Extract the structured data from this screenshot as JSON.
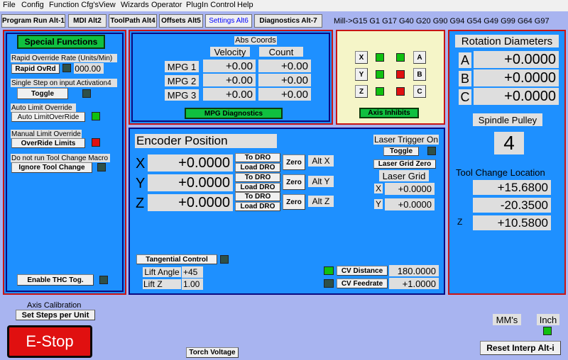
{
  "menu": [
    "File",
    "Config",
    "Function Cfg's",
    "View",
    "Wizards",
    "Operator",
    "PlugIn Control",
    "Help"
  ],
  "tabs": [
    "Program Run Alt-1",
    "MDI Alt2",
    "ToolPath Alt4",
    "Offsets Alt5",
    "Settings Alt6",
    "Diagnostics Alt-7"
  ],
  "active_tab": "Settings Alt6",
  "gcodes": "Mill->G15  G1 G17 G40 G20 G90 G94 G54 G49 G99 G64 G97",
  "special": {
    "title": "Special Functions",
    "rapid_label": "Rapid Override Rate (Units/Min)",
    "rapid_btn": "Rapid OvRd",
    "rapid_value": "000.00",
    "single_step_label": "Single Step on input Activation4",
    "toggle_btn": "Toggle",
    "auto_limit_label": "Auto Limit Override",
    "auto_limit_btn": "Auto LimitOverRide",
    "manual_limit_label": "Manual Limit Override",
    "override_btn": "OverRide Limits",
    "tool_change_label": "Do not run Tool Change Macro",
    "ignore_btn": "Ignore Tool Change",
    "thc_btn": "Enable THC Tog."
  },
  "mpg": {
    "title": "Abs Coords",
    "col_velocity": "Velocity",
    "col_count": "Count",
    "rows": [
      {
        "label": "MPG 1",
        "velocity": "+0.00",
        "count": "+0.00"
      },
      {
        "label": "MPG 2",
        "velocity": "+0.00",
        "count": "+0.00"
      },
      {
        "label": "MPG 3",
        "velocity": "+0.00",
        "count": "+0.00"
      }
    ],
    "diag_btn": "MPG Diagnostics"
  },
  "inhibits": {
    "left": [
      "X",
      "Y",
      "Z"
    ],
    "right": [
      "A",
      "B",
      "C"
    ],
    "btn": "Axis Inhibits",
    "led_left": [
      "green",
      "green",
      "green"
    ],
    "led_right": [
      "green",
      "red",
      "red"
    ]
  },
  "encoder": {
    "title": "Encoder Position",
    "rows": [
      {
        "axis": "X",
        "value": "+0.0000",
        "alt": "Alt X"
      },
      {
        "axis": "Y",
        "value": "+0.0000",
        "alt": "Alt Y"
      },
      {
        "axis": "Z",
        "value": "+0.0000",
        "alt": "Alt Z"
      }
    ],
    "to_dro": "To DRO",
    "load_dro": "Load DRO",
    "zero": "Zero",
    "laser_trigger": "Laser Trigger On",
    "laser_toggle": "Toggle",
    "laser_grid_zero": "Laser Grid Zero",
    "laser_grid": "Laser Grid",
    "grid_x": "+0.0000",
    "grid_y": "+0.0000",
    "tangential": "Tangential Control",
    "lift_angle_label": "Lift Angle",
    "lift_angle": "+45",
    "lift_z_label": "Lift Z",
    "lift_z": "1.00",
    "cv_distance_btn": "CV Distance",
    "cv_distance": "180.0000",
    "cv_feedrate_btn": "CV Feedrate",
    "cv_feedrate": "+1.0000"
  },
  "rotation": {
    "title": "Rotation Diameters",
    "rows": [
      {
        "axis": "A",
        "value": "+0.0000"
      },
      {
        "axis": "B",
        "value": "+0.0000"
      },
      {
        "axis": "C",
        "value": "+0.0000"
      }
    ],
    "spindle_label": "Spindle Pulley",
    "spindle_value": "4",
    "tool_change_label": "Tool Change Location",
    "tc_x": "+15.6800",
    "tc_y": "-20.3500",
    "tc_z_label": "Z",
    "tc_z": "+10.5800"
  },
  "bottom": {
    "axis_cal_label": "Axis Calibration",
    "set_steps_btn": "Set Steps per Unit",
    "estop": "E-Stop",
    "torch_btn": "Torch Voltage",
    "mms": "MM's",
    "inch": "Inch",
    "reset_btn": "Reset Interp Alt-i"
  },
  "colors": {
    "panel": "#1e90ff",
    "panel_border": "#c81414",
    "background": "#a8b4f0",
    "estop": "#e01010"
  }
}
